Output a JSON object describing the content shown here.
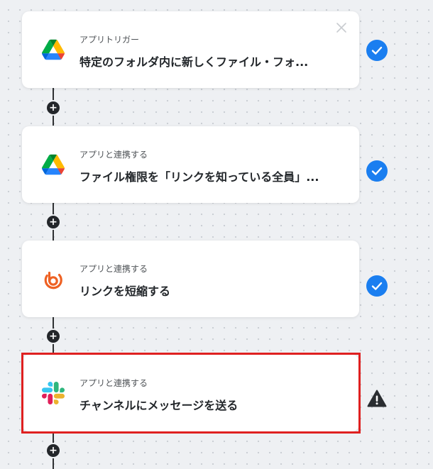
{
  "flow": {
    "steps": [
      {
        "subtitle": "アプリトリガー",
        "title": "特定のフォルダ内に新しくファイル・フォ...",
        "icon": "google-drive-icon",
        "status": "complete"
      },
      {
        "subtitle": "アプリと連携する",
        "title": "ファイル権限を「リンクを知っている全員」...",
        "icon": "google-drive-icon",
        "status": "complete"
      },
      {
        "subtitle": "アプリと連携する",
        "title": "リンクを短縮する",
        "icon": "bitly-icon",
        "status": "complete"
      },
      {
        "subtitle": "アプリと連携する",
        "title": "チャンネルにメッセージを送る",
        "icon": "slack-icon",
        "status": "warning"
      }
    ],
    "add_step_symbol": "+"
  },
  "colors": {
    "check_blue": "#1a7ef0",
    "highlight_red": "#df2020",
    "warning_dark": "#2a2d31",
    "bitly_orange": "#ee6123"
  }
}
